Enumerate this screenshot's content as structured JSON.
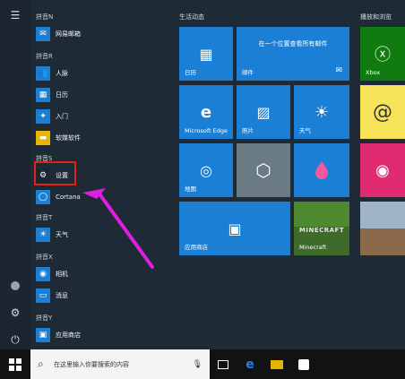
{
  "groups": {
    "n": "拼音N",
    "r": "拼音R",
    "s": "拼音S",
    "t": "拼音T",
    "x": "拼音X",
    "y": "拼音Y"
  },
  "apps": {
    "weibo": "网易邮箱",
    "people": "人脉",
    "calendar": "日历",
    "getstarted": "入门",
    "software": "软媒软件",
    "settings": "设置",
    "cortana": "Cortana",
    "weather": "天气",
    "camera": "相机",
    "messaging": "消息",
    "store": "应用商店"
  },
  "tiles": {
    "section_life": "生活动态",
    "section_play": "播放和浏览",
    "calendar": "日历",
    "mail_title": "在一个位置查看所有邮件",
    "mail": "邮件",
    "edge": "Microsoft Edge",
    "photos": "照片",
    "weather": "天气",
    "maps": "地图",
    "store": "应用商店",
    "minecraft_art": "MINECRAFT",
    "minecraft": "Minecraft",
    "xbox": "Xbox"
  },
  "search": {
    "placeholder": "在这里输入你要搜索的内容"
  },
  "colors": {
    "tile_blue": "#1c7fd6",
    "highlight_red": "#e0231a",
    "arrow_magenta": "#e01ee0"
  }
}
